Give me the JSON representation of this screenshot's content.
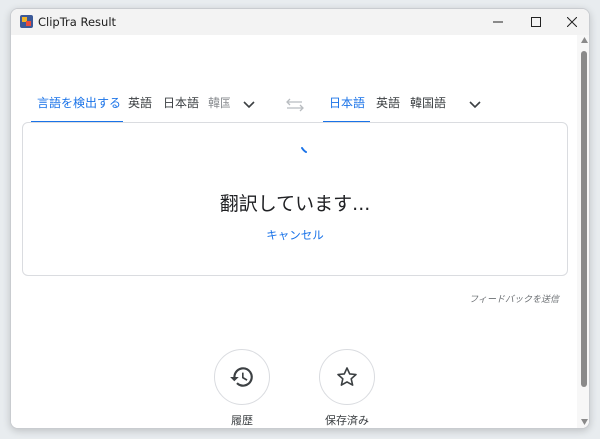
{
  "window": {
    "title": "ClipTra Result"
  },
  "source_tabs": [
    {
      "label": "言語を検出する",
      "active": true
    },
    {
      "label": "英語",
      "active": false
    },
    {
      "label": "日本語",
      "active": false
    },
    {
      "label": "韓国",
      "active": false
    }
  ],
  "target_tabs": [
    {
      "label": "日本語",
      "active": true
    },
    {
      "label": "英語",
      "active": false
    },
    {
      "label": "韓国語",
      "active": false
    }
  ],
  "result_card": {
    "status": "翻訳しています...",
    "cancel_label": "キャンセル"
  },
  "feedback_label": "フィードバックを送信",
  "actions": {
    "history_label": "履歴",
    "saved_label": "保存済み"
  },
  "colors": {
    "accent": "#1a73e8",
    "text": "#202124"
  }
}
